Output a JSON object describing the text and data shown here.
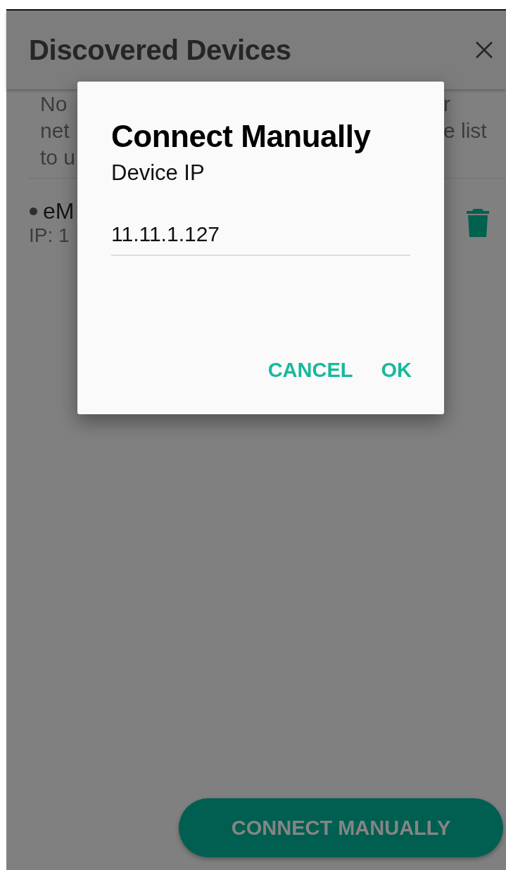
{
  "app_bar": {
    "title": "Discovered Devices"
  },
  "notice": {
    "rows": [
      {
        "left": "No",
        "right": "r"
      },
      {
        "left": "net",
        "right": "e list"
      },
      {
        "left": "to u",
        "right": ""
      }
    ]
  },
  "devices": [
    {
      "name": "eM",
      "ip": "IP: 1"
    }
  ],
  "dialog": {
    "title": "Connect Manually",
    "label": "Device IP",
    "value": "11.11.1.127",
    "buttons": [
      "CANCEL",
      "OK"
    ]
  },
  "fab": {
    "label": "CONNECT MANUALLY"
  }
}
